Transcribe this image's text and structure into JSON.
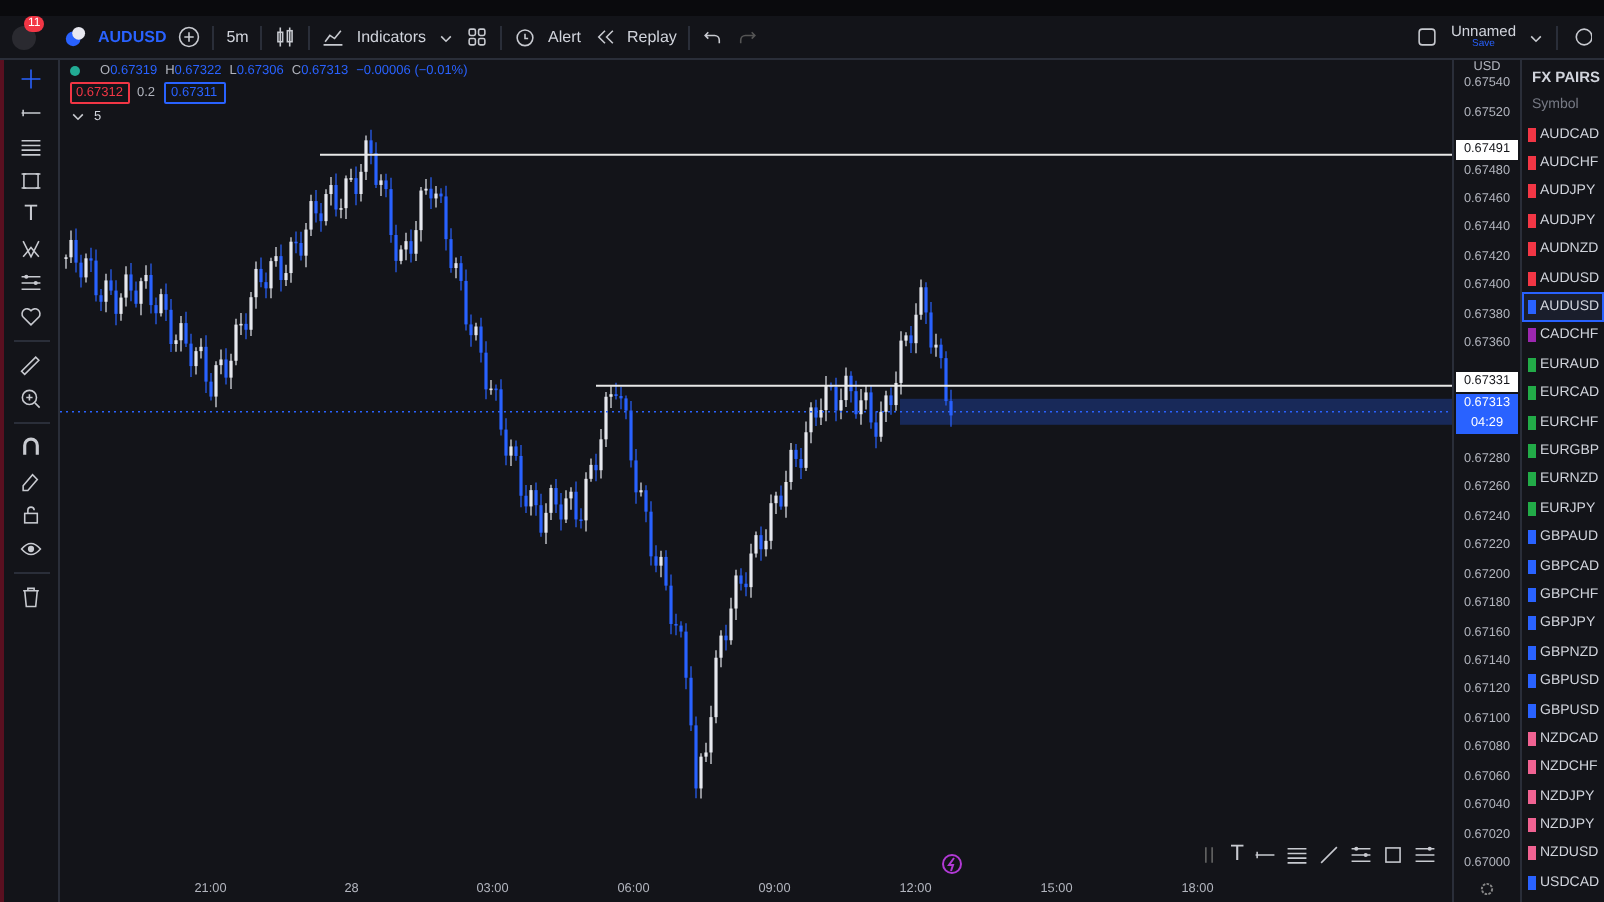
{
  "toolbar": {
    "notifications": "11",
    "symbol": "AUDUSD",
    "interval": "5m",
    "indicators": "Indicators",
    "alert": "Alert",
    "replay": "Replay",
    "layout_name": "Unnamed",
    "save": "Save"
  },
  "left_toolbar": {
    "text_tool": "T"
  },
  "legend": {
    "ohlc": [
      {
        "label": "O",
        "value": "0.67319"
      },
      {
        "label": "H",
        "value": "0.67322"
      },
      {
        "label": "L",
        "value": "0.67306"
      },
      {
        "label": "C",
        "value": "0.67313"
      }
    ],
    "change": "−0.00006 (−0.01%)",
    "sell": "0.67312",
    "spread": "0.2",
    "buy": "0.67311",
    "collapsed_count": "5"
  },
  "price_axis": {
    "currency": "USD",
    "items": [
      {
        "kind": "label",
        "text": "0.67540"
      },
      {
        "kind": "label",
        "text": "0.67520"
      },
      {
        "kind": "line_tag",
        "text": "0.67491"
      },
      {
        "kind": "label",
        "text": "0.67480"
      },
      {
        "kind": "label",
        "text": "0.67460"
      },
      {
        "kind": "label",
        "text": "0.67440"
      },
      {
        "kind": "label",
        "text": "0.67420"
      },
      {
        "kind": "label",
        "text": "0.67400"
      },
      {
        "kind": "label",
        "text": "0.67380"
      },
      {
        "kind": "label",
        "text": "0.67360"
      },
      {
        "kind": "line_tag",
        "text": "0.67331"
      },
      {
        "kind": "current_tag",
        "text": "0.67313",
        "countdown": "04:29"
      },
      {
        "kind": "label",
        "text": "0.67280"
      },
      {
        "kind": "label",
        "text": "0.67260"
      },
      {
        "kind": "label",
        "text": "0.67240"
      },
      {
        "kind": "label",
        "text": "0.67220"
      },
      {
        "kind": "label",
        "text": "0.67200"
      },
      {
        "kind": "label",
        "text": "0.67180"
      },
      {
        "kind": "label",
        "text": "0.67160"
      },
      {
        "kind": "label",
        "text": "0.67140"
      },
      {
        "kind": "label",
        "text": "0.67120"
      },
      {
        "kind": "label",
        "text": "0.67100"
      },
      {
        "kind": "label",
        "text": "0.67080"
      },
      {
        "kind": "label",
        "text": "0.67060"
      },
      {
        "kind": "label",
        "text": "0.67040"
      },
      {
        "kind": "label",
        "text": "0.67020"
      },
      {
        "kind": "label",
        "text": "0.67000"
      }
    ]
  },
  "time_axis": [
    "21:00",
    "28",
    "03:00",
    "06:00",
    "09:00",
    "12:00",
    "15:00",
    "18:00"
  ],
  "drawing_toolbar": {
    "text_tool": "T"
  },
  "watchlist": {
    "title": "FX PAIRS",
    "column": "Symbol",
    "items": [
      {
        "symbol": "AUDCAD",
        "color": "#f23645",
        "selected": false
      },
      {
        "symbol": "AUDCHF",
        "color": "#f23645",
        "selected": false
      },
      {
        "symbol": "AUDJPY",
        "color": "#f23645",
        "selected": false
      },
      {
        "symbol": "AUDJPY",
        "color": "#f23645",
        "selected": false
      },
      {
        "symbol": "AUDNZD",
        "color": "#f23645",
        "selected": false
      },
      {
        "symbol": "AUDUSD",
        "color": "#f23645",
        "selected": false
      },
      {
        "symbol": "AUDUSD",
        "color": "#2962ff",
        "selected": true
      },
      {
        "symbol": "CADCHF",
        "color": "#9c27b0",
        "selected": false
      },
      {
        "symbol": "EURAUD",
        "color": "#22ab48",
        "selected": false
      },
      {
        "symbol": "EURCAD",
        "color": "#22ab48",
        "selected": false
      },
      {
        "symbol": "EURCHF",
        "color": "#22ab48",
        "selected": false
      },
      {
        "symbol": "EURGBP",
        "color": "#22ab48",
        "selected": false
      },
      {
        "symbol": "EURNZD",
        "color": "#22ab48",
        "selected": false
      },
      {
        "symbol": "EURJPY",
        "color": "#22ab48",
        "selected": false
      },
      {
        "symbol": "GBPAUD",
        "color": "#2962ff",
        "selected": false
      },
      {
        "symbol": "GBPCAD",
        "color": "#2962ff",
        "selected": false
      },
      {
        "symbol": "GBPCHF",
        "color": "#2962ff",
        "selected": false
      },
      {
        "symbol": "GBPJPY",
        "color": "#2962ff",
        "selected": false
      },
      {
        "symbol": "GBPNZD",
        "color": "#2962ff",
        "selected": false
      },
      {
        "symbol": "GBPUSD",
        "color": "#2962ff",
        "selected": false
      },
      {
        "symbol": "GBPUSD",
        "color": "#2962ff",
        "selected": false
      },
      {
        "symbol": "NZDCAD",
        "color": "#f06292",
        "selected": false
      },
      {
        "symbol": "NZDCHF",
        "color": "#f06292",
        "selected": false
      },
      {
        "symbol": "NZDJPY",
        "color": "#f06292",
        "selected": false
      },
      {
        "symbol": "NZDJPY",
        "color": "#f06292",
        "selected": false
      },
      {
        "symbol": "NZDUSD",
        "color": "#f06292",
        "selected": false
      },
      {
        "symbol": "USDCAD",
        "color": "#2962ff",
        "selected": false
      }
    ]
  }
}
